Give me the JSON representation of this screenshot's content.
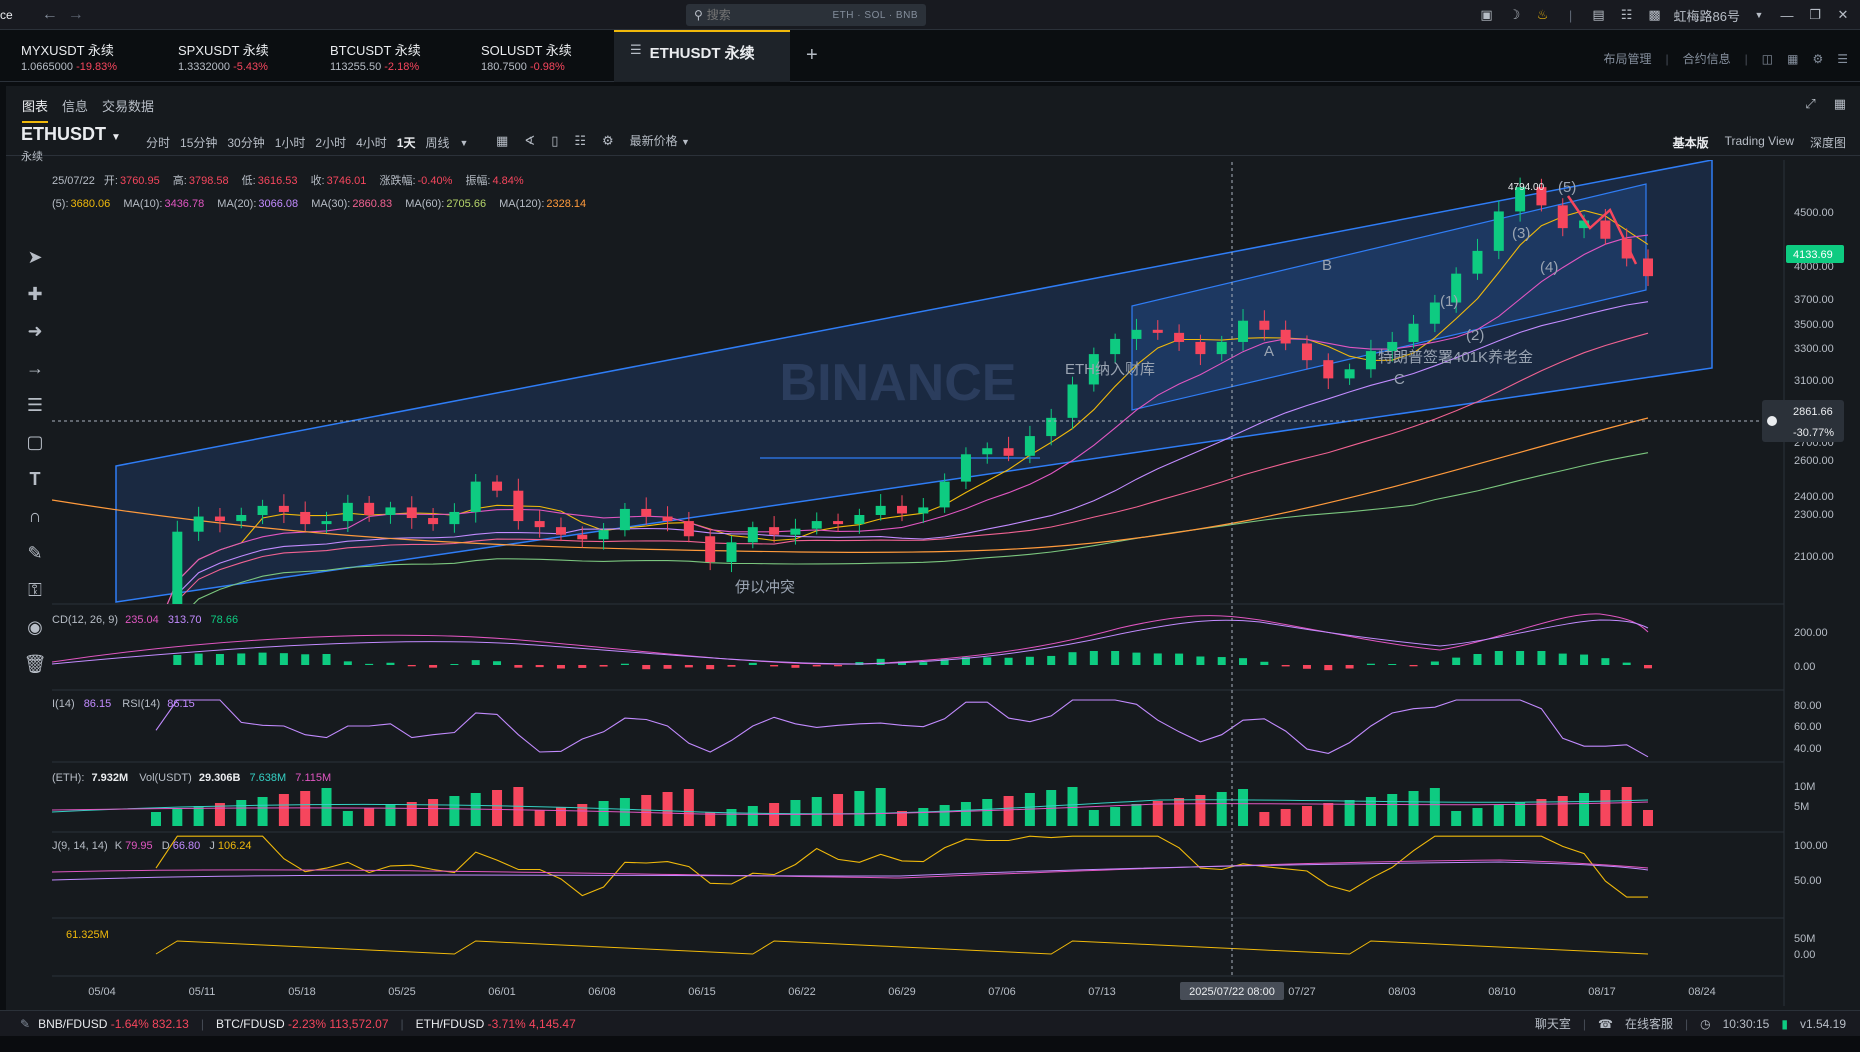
{
  "topbar": {
    "app_fragment": "ce",
    "search_placeholder": "搜索",
    "search_tags": "ETH · SOL · BNB",
    "user_name": "虹梅路86号"
  },
  "pair_tabs": [
    {
      "symbol": "MYXUSDT 永续",
      "price": "1.0665000",
      "change": "-19.83%"
    },
    {
      "symbol": "SPXUSDT 永续",
      "price": "1.3332000",
      "change": "-5.43%"
    },
    {
      "symbol": "BTCUSDT 永续",
      "price": "113255.50",
      "change": "-2.18%"
    },
    {
      "symbol": "SOLUSDT 永续",
      "price": "180.7500",
      "change": "-0.98%"
    }
  ],
  "active_tab": {
    "symbol": "ETHUSDT 永续"
  },
  "tabs_right": {
    "layout": "布局管理",
    "contract_info": "合约信息"
  },
  "subtabs": [
    "图表",
    "信息",
    "交易数据"
  ],
  "symbol": {
    "name": "ETHUSDT",
    "sub": "永续"
  },
  "intervals": [
    "分时",
    "15分钟",
    "30分钟",
    "1小时",
    "2小时",
    "4小时",
    "1天",
    "周线"
  ],
  "active_interval": "1天",
  "price_mode": "最新价格",
  "views": [
    "基本版",
    "Trading View",
    "深度图"
  ],
  "ohlc": {
    "date": "25/07/22",
    "open_label": "开:",
    "open": "3760.95",
    "high_label": "高:",
    "high": "3798.58",
    "low_label": "低:",
    "low": "3616.53",
    "close_label": "收:",
    "close": "3746.01",
    "chg_label": "涨跌幅:",
    "chg": "-0.40%",
    "amp_label": "振幅:",
    "amp": "4.84%"
  },
  "ma_line": {
    "ma5_label": "(5):",
    "ma5": "3680.06",
    "ma10_label": "MA(10):",
    "ma10": "3436.78",
    "ma20_label": "MA(20):",
    "ma20": "3066.08",
    "ma30_label": "MA(30):",
    "ma30": "2860.83",
    "ma60_label": "MA(60):",
    "ma60": "2705.66",
    "ma120_label": "MA(120):",
    "ma120": "2328.14"
  },
  "macd_info": {
    "label": "CD(12, 26, 9)",
    "v1": "235.04",
    "v2": "313.70",
    "v3": "78.66"
  },
  "rsi_info": {
    "label": "I(14)",
    "v1": "86.15",
    "label2": "RSI(14)",
    "v2": "86.15"
  },
  "vol_info": {
    "label": "(ETH):",
    "v1": "7.932M",
    "label2": "Vol(USDT)",
    "v2": "29.306B",
    "v3": "7.638M",
    "v4": "7.115M"
  },
  "kdj_info": {
    "label": "J(9, 14, 14)",
    "k_label": "K",
    "k": "79.95",
    "d_label": "D",
    "d": "66.80",
    "j_label": "J",
    "j": "106.24"
  },
  "extra_info": {
    "v": "61.325M"
  },
  "price_axis": [
    "4500.00",
    "4000.00",
    "3700.00",
    "3500.00",
    "3300.00",
    "3100.00",
    "2700.00",
    "2600.00",
    "2400.00",
    "2300.00",
    "2100.00"
  ],
  "current_price": "4133.69",
  "cursor_price": "2861.66",
  "cursor_pct": "-30.77%",
  "high_marker": "4794.00",
  "macd_axis": [
    "200.00",
    "0.00"
  ],
  "rsi_axis": [
    "80.00",
    "60.00",
    "40.00"
  ],
  "vol_axis": [
    "10M",
    "5M"
  ],
  "kdj_axis": [
    "100.00",
    "50.00"
  ],
  "extra_axis": [
    "50M",
    "0.00"
  ],
  "date_axis": [
    "05/04",
    "05/11",
    "05/18",
    "05/25",
    "06/01",
    "06/08",
    "06/15",
    "06/22",
    "06/29",
    "07/06",
    "07/13",
    "07/27",
    "08/03",
    "08/10",
    "08/17",
    "08/24"
  ],
  "cursor_date": "2025/07/22 08:00",
  "annotations": {
    "event1": "伊以冲突",
    "event2": "ETH纳入财库",
    "event3": "特朗普签署401K养老金",
    "wave_a": "A",
    "wave_b": "B",
    "wave_c": "C",
    "wave_2": "(2)",
    "wave_3": "(3)",
    "wave_4": "(4)",
    "wave_5": "(5)",
    "wave_1": "(1)"
  },
  "watermark": "BINANCE",
  "bottom": {
    "t1": "BNB/FDUSD",
    "t1c": "-1.64%",
    "t1p": "832.13",
    "t2": "BTC/FDUSD",
    "t2c": "-2.23%",
    "t2p": "113,572.07",
    "t3": "ETH/FDUSD",
    "t3c": "-3.71%",
    "t3p": "4,145.47",
    "chat": "聊天室",
    "service": "在线客服",
    "time": "10:30:15",
    "version": "v1.54.19"
  },
  "colors": {
    "up": "#0ecb81",
    "down": "#f6465d",
    "accent": "#f0b90b",
    "channel": "#2f7df6"
  },
  "chart_data": {
    "type": "candlestick",
    "timeframe": "1天",
    "series": [
      {
        "name": "ETHUSDT",
        "ohlc_sample": {
          "date": "2025/07/22",
          "open": 3760.95,
          "high": 3798.58,
          "low": 3616.53,
          "close": 3746.01
        }
      },
      {
        "name": "MA(10)",
        "last": 3436.78
      },
      {
        "name": "MA(20)",
        "last": 3066.08
      },
      {
        "name": "MA(30)",
        "last": 2860.83
      },
      {
        "name": "MA(60)",
        "last": 2705.66
      },
      {
        "name": "MA(120)",
        "last": 2328.14
      }
    ],
    "close_path": [
      1800,
      2450,
      2550,
      2520,
      2560,
      2620,
      2580,
      2500,
      2520,
      2640,
      2560,
      2610,
      2540,
      2500,
      2580,
      2780,
      2720,
      2520,
      2480,
      2430,
      2400,
      2460,
      2600,
      2550,
      2520,
      2420,
      2250,
      2380,
      2480,
      2430,
      2470,
      2520,
      2500,
      2560,
      2620,
      2570,
      2610,
      2780,
      2960,
      3000,
      2950,
      3080,
      3200,
      3420,
      3620,
      3720,
      3780,
      3760,
      3700,
      3620,
      3700,
      3840,
      3780,
      3690,
      3580,
      3460,
      3520,
      3640,
      3700,
      3820,
      3960,
      4150,
      4300,
      4560,
      4720,
      4600,
      4450,
      4500,
      4380,
      4250,
      4133.69
    ],
    "ylim": [
      2000,
      4800
    ],
    "x_range": [
      "2025/04/30",
      "2025/08/21"
    ]
  }
}
